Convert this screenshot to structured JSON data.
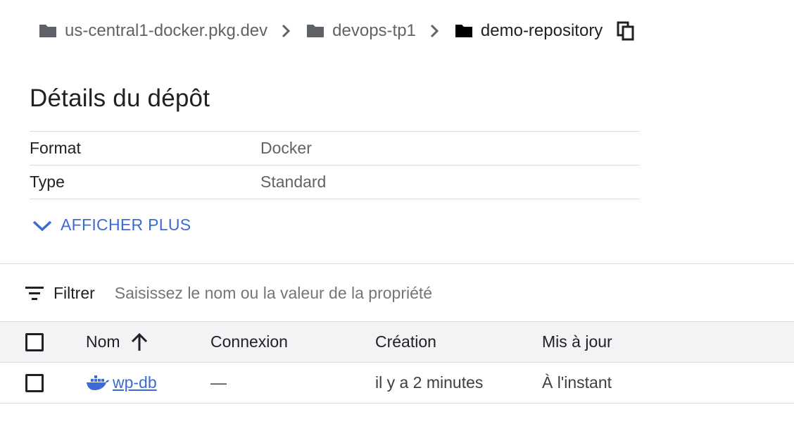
{
  "breadcrumb": {
    "items": [
      {
        "label": "us-central1-docker.pkg.dev",
        "icon": "folder-icon"
      },
      {
        "label": "devops-tp1",
        "icon": "folder-icon"
      },
      {
        "label": "demo-repository",
        "icon": "folder-icon"
      }
    ],
    "copy_icon": "copy-icon"
  },
  "details": {
    "title": "Détails du dépôt",
    "rows": [
      {
        "key": "Format",
        "value": "Docker"
      },
      {
        "key": "Type",
        "value": "Standard"
      }
    ],
    "show_more_label": "AFFICHER PLUS"
  },
  "filter": {
    "label": "Filtrer",
    "placeholder": "Saisissez le nom ou la valeur de la propriété"
  },
  "table": {
    "columns": {
      "name": "Nom",
      "connection": "Connexion",
      "created": "Création",
      "updated": "Mis à jour"
    },
    "sort": "ascending",
    "rows": [
      {
        "name": "wp-db",
        "icon": "docker-icon",
        "connection": "—",
        "created": "il y a 2 minutes",
        "updated": "À l'instant"
      }
    ]
  },
  "colors": {
    "accent": "#3c6ad6",
    "text_primary": "#202124",
    "text_secondary": "#5f6368",
    "divider": "#dadce0",
    "header_bg": "#f1f3f4"
  }
}
